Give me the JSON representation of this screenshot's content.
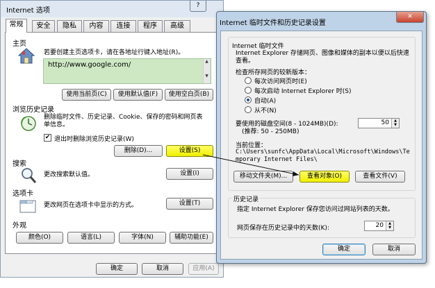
{
  "options_window": {
    "title": "Internet 选项",
    "help_label": "?",
    "close_label": "✕",
    "tabs": [
      {
        "label": "常规"
      },
      {
        "label": "安全"
      },
      {
        "label": "隐私"
      },
      {
        "label": "内容"
      },
      {
        "label": "连接"
      },
      {
        "label": "程序"
      },
      {
        "label": "高级"
      }
    ],
    "home": {
      "section_title": "主页",
      "description": "若要创建主页选项卡，请在各地址行键入地址(R)。",
      "url": "http://www.google.com/",
      "use_current": "使用当前页(C)",
      "use_default": "使用默认值(F)",
      "use_blank": "使用空白页(B)"
    },
    "history": {
      "section_title": "浏览历史记录",
      "description": "删除临时文件、历史记录、Cookie、保存的密码和网页表单信息。",
      "delete_on_exit": "退出时删除浏览历史记录(W)",
      "delete_on_exit_checked": true,
      "delete_button": "删除(D)...",
      "settings_button": "设置(S)"
    },
    "search": {
      "section_title": "搜索",
      "description": "更改搜索默认值。",
      "settings_button": "设置(I)"
    },
    "tabs_section": {
      "section_title": "选项卡",
      "description": "更改网页在选项卡中显示的方式。",
      "settings_button": "设置(T)"
    },
    "appearance": {
      "section_title": "外观",
      "colors": "颜色(O)",
      "languages": "语言(L)",
      "fonts": "字体(N)",
      "accessibility": "辅助功能(E)"
    },
    "footer": {
      "ok": "确定",
      "cancel": "取消",
      "apply": "应用(A)"
    }
  },
  "temp_dialog": {
    "title": "Internet 临时文件和历史记录设置",
    "close_label": "✕",
    "temp_files": {
      "group_title": "Internet 临时文件",
      "description": "Internet Explorer 存储网页、图像和媒体的副本以便以后快速查看。",
      "check_label": "检查所存网页的较新版本：",
      "options": [
        {
          "label": "每次访问网页时(E)",
          "selected": false
        },
        {
          "label": "每次启动 Internet Explorer 时(S)",
          "selected": false
        },
        {
          "label": "自动(A)",
          "selected": true
        },
        {
          "label": "从不(N)",
          "selected": false
        }
      ],
      "disk_space_label": "要使用的磁盘空间(8 - 1024MB)(D):",
      "disk_space_hint": "(推荐: 50 - 250MB)",
      "disk_space_value": "50",
      "location_label": "当前位置：",
      "location_path": "C:\\Users\\sunfc\\AppData\\Local\\Microsoft\\Windows\\Temporary Internet Files\\",
      "move_folder": "移动文件夹(M)...",
      "view_objects": "查看对象(O)",
      "view_files": "查看文件(V)"
    },
    "history": {
      "group_title": "历史记录",
      "description": "指定 Internet Explorer 保存您访问过网站列表的天数。",
      "days_label": "网页保存在历史记录中的天数(K):",
      "days_value": "20"
    },
    "footer": {
      "ok": "确定",
      "cancel": "取消"
    }
  },
  "colors": {
    "highlight": "#f0f000",
    "url_bg": "#cde8c3",
    "dialog_frame": "#bfd3e8"
  }
}
